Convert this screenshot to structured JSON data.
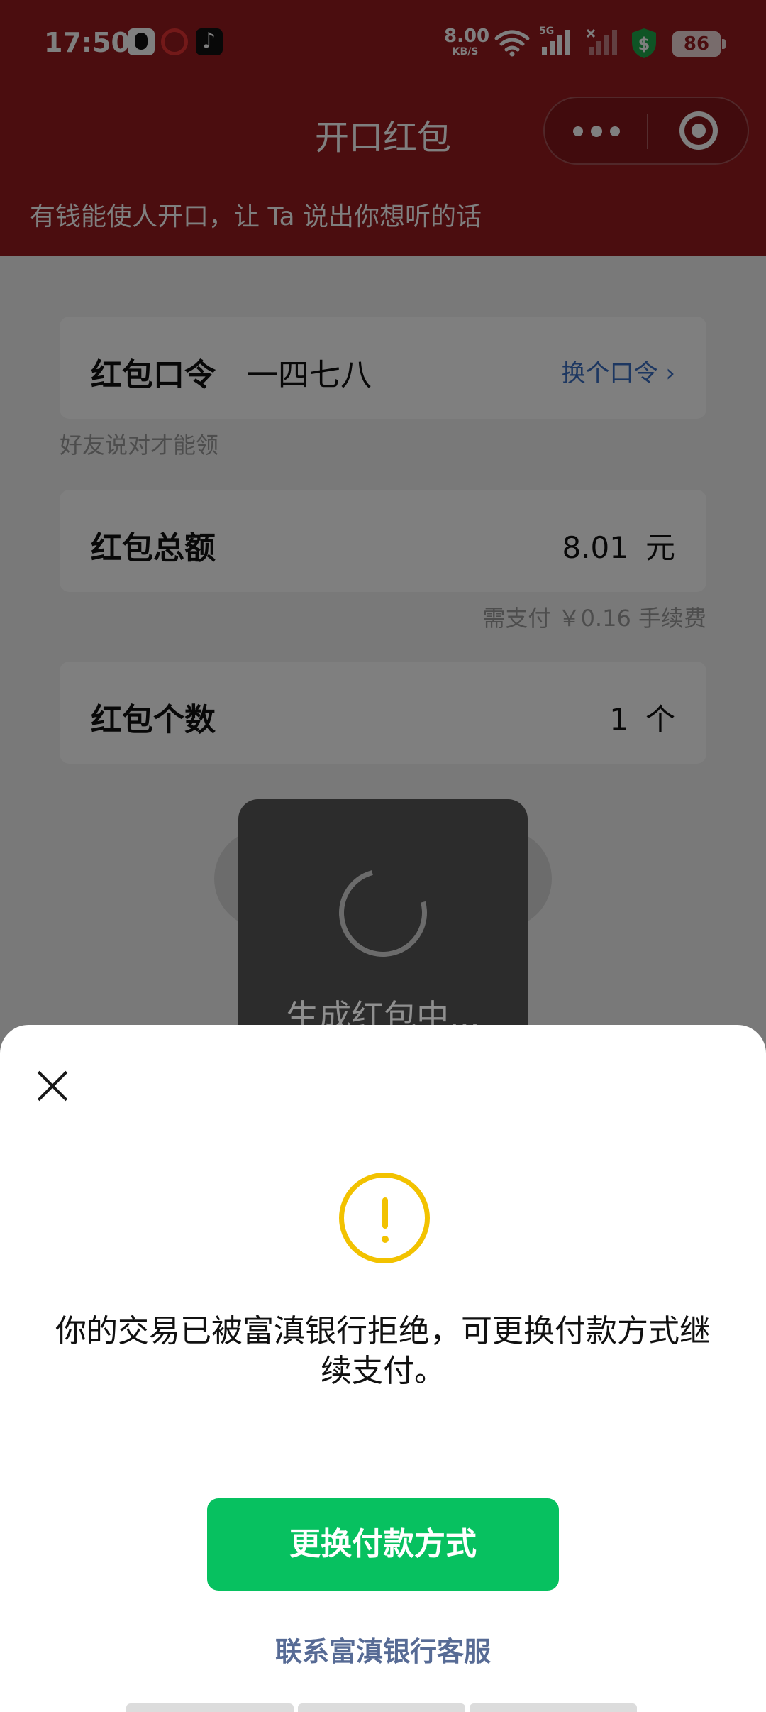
{
  "status_bar": {
    "time": "17:50",
    "net_speed_value": "8.00",
    "net_speed_unit": "KB/S",
    "network_label": "5G",
    "battery": "86",
    "app_icons": [
      "qq-icon",
      "unionpay-icon",
      "tiktok-icon"
    ]
  },
  "header": {
    "title": "开口红包",
    "subtitle": "有钱能使人开口，让 Ta 说出你想听的话",
    "background_color": "#961b1f"
  },
  "form": {
    "password": {
      "label": "红包口令",
      "value": "一四七八",
      "change_link": "换个口令 ›",
      "hint": "好友说对才能领"
    },
    "amount": {
      "label": "红包总额",
      "value": "8.01",
      "unit": "元",
      "fee_note": "需支付 ￥0.16 手续费"
    },
    "count": {
      "label": "红包个数",
      "value": "1",
      "unit": "个"
    }
  },
  "toast": {
    "text": "生成红包中..."
  },
  "sheet": {
    "message": "你的交易已被富滇银行拒绝，可更换付款方式继续支付。",
    "primary_button": "更换付款方式",
    "contact_link": "联系富滇银行客服",
    "accent_color": "#07c160",
    "warning_color": "#f2c200"
  }
}
